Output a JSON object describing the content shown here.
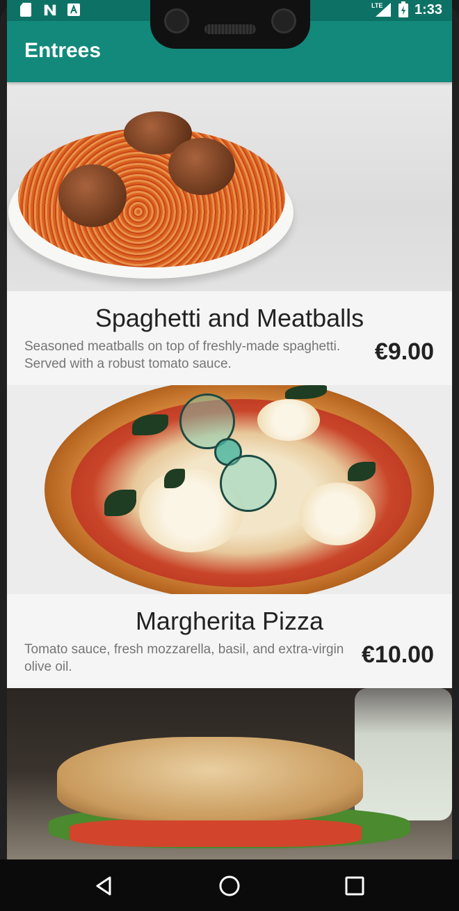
{
  "status_bar": {
    "time": "1:33",
    "left_icons": [
      "sd-card-icon",
      "n-logo-icon",
      "text-a-icon"
    ],
    "right_icons": [
      "lte-signal-icon",
      "battery-charging-icon"
    ],
    "lte_label": "LTE"
  },
  "app_bar": {
    "title": "Entrees"
  },
  "colors": {
    "status_bar": "#0d7265",
    "app_bar": "#13897b",
    "background": "#f5f5f5",
    "price_text": "#222222",
    "description_text": "#757575"
  },
  "menu": {
    "items": [
      {
        "name": "Spaghetti and Meatballs",
        "description": "Seasoned meatballs on top of freshly-made spaghetti. Served with a robust tomato sauce.",
        "price": "€9.00"
      },
      {
        "name": "Margherita Pizza",
        "description": "Tomato sauce, fresh mozzarella, basil, and extra-virgin olive oil.",
        "price": "€10.00"
      },
      {
        "name": "",
        "description": "",
        "price": ""
      }
    ]
  },
  "nav_bar": {
    "buttons": [
      "back-icon",
      "home-icon",
      "recents-icon"
    ]
  }
}
